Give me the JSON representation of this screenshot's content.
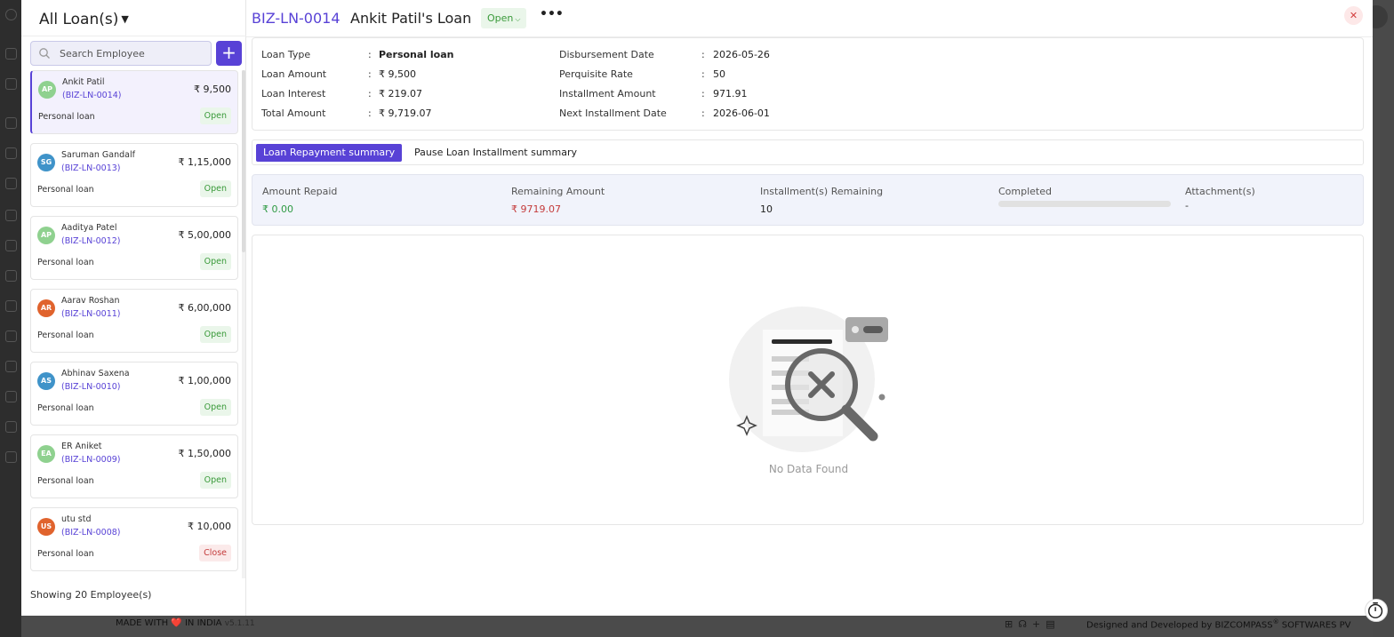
{
  "colors": {
    "accent": "#5842d6",
    "open": "#3a9a3a",
    "close": "#c43b3b"
  },
  "left_panel": {
    "heading": "All Loan(s)",
    "search_placeholder": "Search Employee",
    "add_label": "+",
    "loans": [
      {
        "initials": "AP",
        "avatar_color": "#8fd18f",
        "name": "Ankit Patil",
        "code": "(BIZ-LN-0014)",
        "amount": "₹ 9,500",
        "type": "Personal loan",
        "status": "Open",
        "status_kind": "open",
        "active": true
      },
      {
        "initials": "SG",
        "avatar_color": "#3f93c9",
        "name": "Saruman Gandalf",
        "code": "(BIZ-LN-0013)",
        "amount": "₹ 1,15,000",
        "type": "Personal loan",
        "status": "Open",
        "status_kind": "open",
        "active": false
      },
      {
        "initials": "AP",
        "avatar_color": "#8fd18f",
        "name": "Aaditya Patel",
        "code": "(BIZ-LN-0012)",
        "amount": "₹ 5,00,000",
        "type": "Personal loan",
        "status": "Open",
        "status_kind": "open",
        "active": false
      },
      {
        "initials": "AR",
        "avatar_color": "#e0632d",
        "name": "Aarav Roshan",
        "code": "(BIZ-LN-0011)",
        "amount": "₹ 6,00,000",
        "type": "Personal loan",
        "status": "Open",
        "status_kind": "open",
        "active": false
      },
      {
        "initials": "AS",
        "avatar_color": "#3f93c9",
        "name": "Abhinav Saxena",
        "code": "(BIZ-LN-0010)",
        "amount": "₹ 1,00,000",
        "type": "Personal loan",
        "status": "Open",
        "status_kind": "open",
        "active": false
      },
      {
        "initials": "EA",
        "avatar_color": "#8fd18f",
        "name": "ER Aniket",
        "code": "(BIZ-LN-0009)",
        "amount": "₹ 1,50,000",
        "type": "Personal loan",
        "status": "Open",
        "status_kind": "open",
        "active": false
      },
      {
        "initials": "US",
        "avatar_color": "#e0632d",
        "name": "utu std",
        "code": "(BIZ-LN-0008)",
        "amount": "₹ 10,000",
        "type": "Personal loan",
        "status": "Close",
        "status_kind": "close",
        "active": false
      }
    ],
    "footer": "Showing 20 Employee(s)"
  },
  "header": {
    "code": "BIZ-LN-0014",
    "title": "Ankit Patil's Loan",
    "status": "Open"
  },
  "details": {
    "left": [
      {
        "label": "Loan Type",
        "value": "Personal loan",
        "bold": true
      },
      {
        "label": "Loan Amount",
        "value": "₹ 9,500",
        "bold": false
      },
      {
        "label": "Loan Interest",
        "value": "₹ 219.07",
        "bold": false
      },
      {
        "label": "Total Amount",
        "value": "₹ 9,719.07",
        "bold": false
      }
    ],
    "right": [
      {
        "label": "Disbursement Date",
        "value": "2026-05-26"
      },
      {
        "label": "Perquisite Rate",
        "value": "50"
      },
      {
        "label": "Installment Amount",
        "value": "971.91"
      },
      {
        "label": "Next Installment Date",
        "value": "2026-06-01"
      }
    ]
  },
  "tabs": {
    "active": "Loan Repayment summary",
    "other": "Pause Loan Installment summary"
  },
  "summary": {
    "amount_repaid_label": "Amount Repaid",
    "amount_repaid": "₹ 0.00",
    "remaining_amount_label": "Remaining Amount",
    "remaining_amount": "₹ 9719.07",
    "installments_remaining_label": "Installment(s) Remaining",
    "installments_remaining": "10",
    "completed_label": "Completed",
    "completed_fraction": 0,
    "attachments_label": "Attachment(s)",
    "attachments": "-"
  },
  "empty_state": {
    "text": "No Data Found"
  },
  "footer_bar": {
    "made_with": "MADE WITH",
    "heart": "❤️",
    "in_india": "IN INDIA",
    "version": "v5.1.11",
    "designed_by": "Designed and Developed by",
    "company": "BIZCOMPASS",
    "registered": "®",
    "company_suffix": "SOFTWARES PV"
  }
}
